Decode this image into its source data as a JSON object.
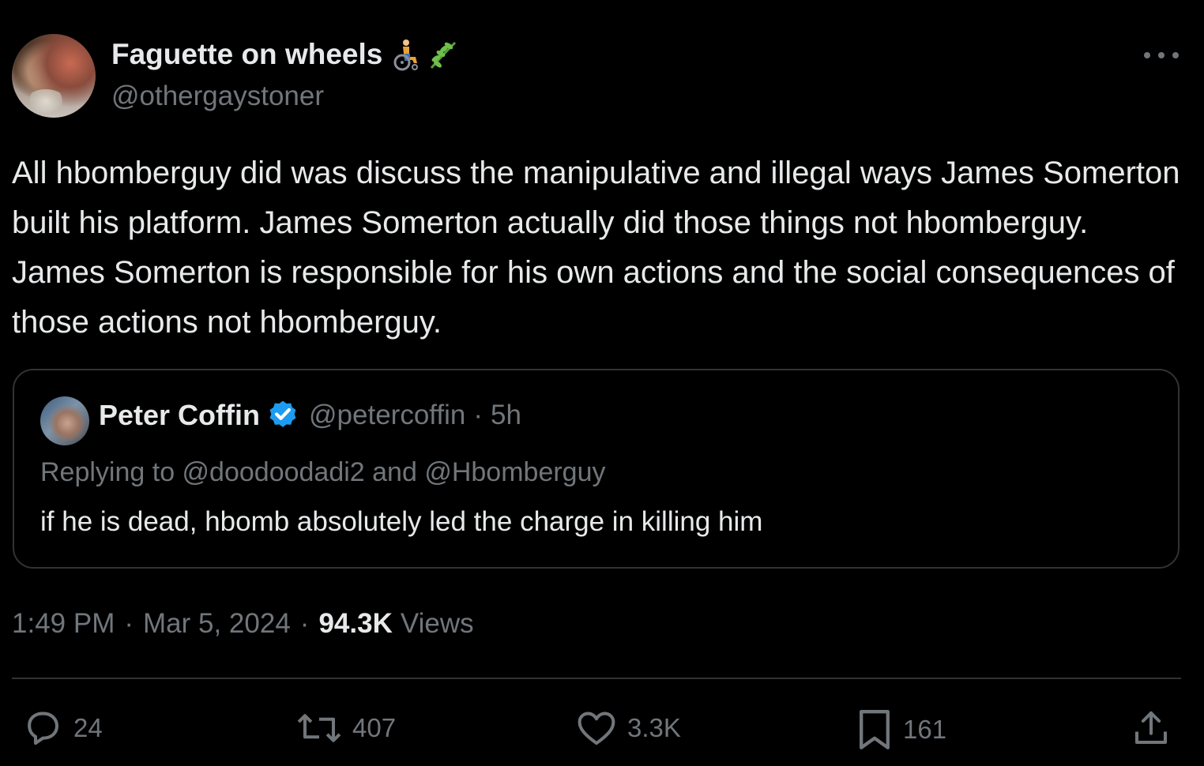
{
  "author": {
    "display_name": "Faguette on wheels",
    "handle": "@othergaystoner",
    "emoji_icons": [
      "wheelchair-person-icon",
      "herb-icon"
    ]
  },
  "tweet": {
    "text": "All hbomberguy did was discuss the manipulative and illegal ways James Somerton built his platform. James Somerton actually did those things not hbomberguy. James Somerton is responsible for his own actions and the social consequences of those actions not hbomberguy."
  },
  "quoted_tweet": {
    "display_name": "Peter Coffin",
    "handle": "@petercoffin",
    "separator": "·",
    "time": "5h",
    "replying_to": "Replying to @doodoodadi2 and @Hbomberguy",
    "text": "if he is dead, hbomb absolutely led the charge in killing him"
  },
  "meta": {
    "time": "1:49 PM",
    "sep1": "·",
    "date": "Mar 5, 2024",
    "sep2": "·",
    "views_count": "94.3K",
    "views_label": "Views"
  },
  "actions": {
    "replies": "24",
    "reposts": "407",
    "likes": "3.3K",
    "bookmarks": "161"
  },
  "colors": {
    "background": "#000000",
    "text_primary": "#e7e9ea",
    "text_secondary": "#71767b",
    "border": "#2f3336",
    "verified_blue": "#1d9bf0"
  }
}
